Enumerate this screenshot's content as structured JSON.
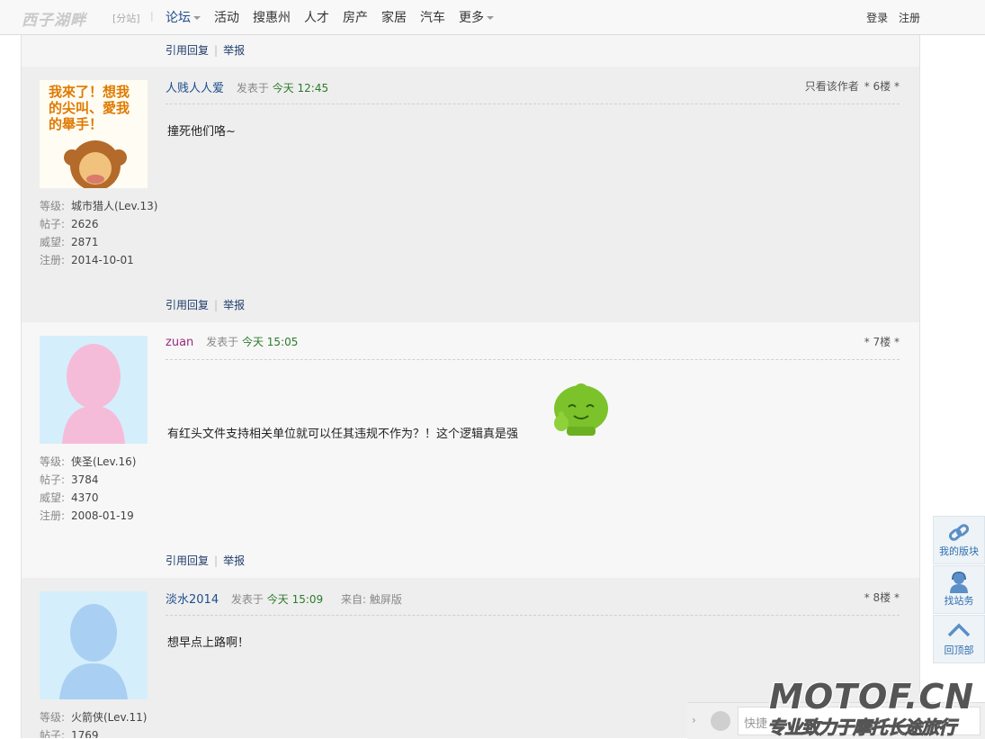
{
  "header": {
    "logo": "西子湖畔",
    "branch": "[分站]",
    "separator": "|",
    "nav": [
      "论坛",
      "活动",
      "搜惠州",
      "人才",
      "房产",
      "家居",
      "汽车",
      "更多"
    ],
    "login": "登录",
    "register": "注册"
  },
  "actions": {
    "quote_reply": "引用回复",
    "separator": "|",
    "report": "举报"
  },
  "labels": {
    "posted_at": "发表于",
    "level": "等级:",
    "posts": "帖子:",
    "prestige": "威望:",
    "registered": "注册:",
    "from": "来自:"
  },
  "posts": [
    {
      "username": "人贱人人爱",
      "today": "今天",
      "time": "12:45",
      "only_author": "只看该作者",
      "floor": "* 6楼 *",
      "content": "撞死他们咯~",
      "level": "城市猎人(Lev.13)",
      "post_count": "2626",
      "prestige": "2871",
      "register_date": "2014-10-01",
      "avatar_text": "我来了！想我的尖叫、爱我的举手！"
    },
    {
      "username": "zuan",
      "today": "今天",
      "time": "15:05",
      "floor": "* 7楼 *",
      "content": "有红头文件支持相关单位就可以任其违规不作为？！这个逻辑真是强",
      "level": "侠圣(Lev.16)",
      "post_count": "3784",
      "prestige": "4370",
      "register_date": "2008-01-19"
    },
    {
      "username": "淡水2014",
      "today": "今天",
      "time": "15:09",
      "source": "触屏版",
      "floor": "* 8楼 *",
      "content": "想早点上路啊！",
      "level": "火箭侠(Lev.11)",
      "post_count": "1769"
    }
  ],
  "sidetools": [
    "我的版块",
    "找站务",
    "回顶部"
  ],
  "quick_reply": {
    "placeholder": "快捷"
  },
  "watermark": {
    "main": "MOTOF.CN",
    "sub": "专业致力于摩托长途旅行"
  },
  "colors": {
    "link_blue": "#1f4e8c",
    "today_green": "#2c7b2c",
    "username_purple": "#9b2a7d"
  }
}
